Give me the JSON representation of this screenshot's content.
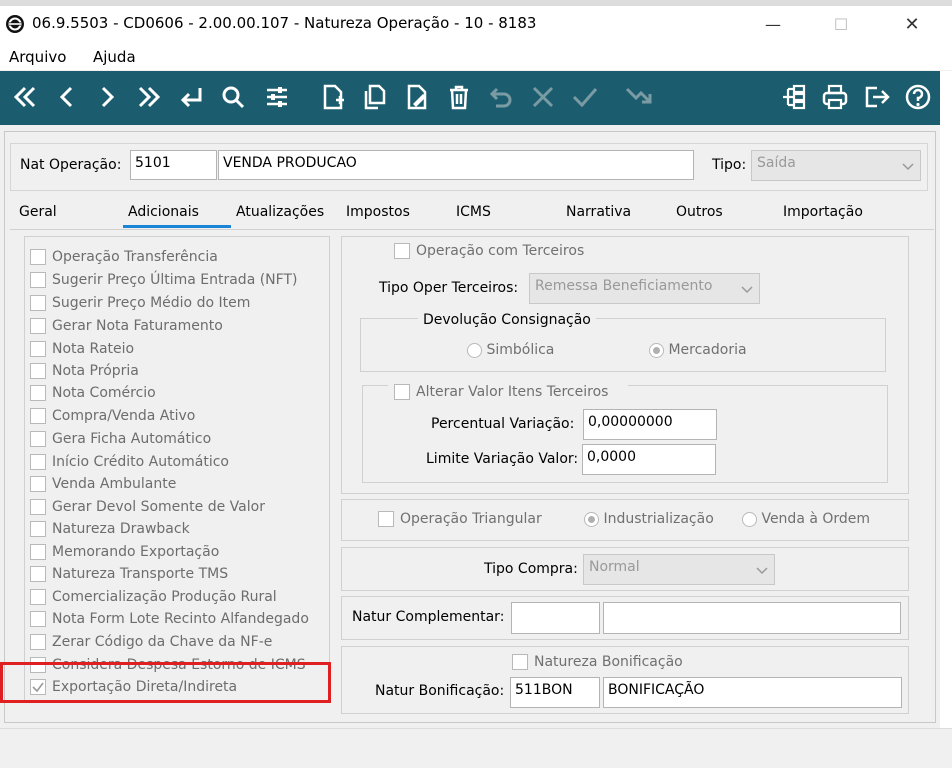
{
  "window": {
    "title": "06.9.5503 - CD0606 - 2.00.00.107 - Natureza Operação - 10 - 8183",
    "minimize_glyph": "—",
    "maximize_glyph": "☐",
    "close_glyph": "✕"
  },
  "menu": {
    "items": [
      "Arquivo",
      "Ajuda"
    ]
  },
  "toolbar": {
    "icons": [
      "first-icon",
      "previous-icon",
      "next-icon",
      "last-icon",
      "goto-icon",
      "search-icon",
      "filter-icon",
      "new-icon",
      "copy-icon",
      "edit-icon",
      "delete-icon",
      "undo-icon",
      "cancel-icon",
      "confirm-icon",
      "send-icon",
      "tree-icon",
      "print-icon",
      "exit-icon",
      "help-icon"
    ]
  },
  "header": {
    "nat_label": "Nat Operação:",
    "nat_code": "5101",
    "nat_desc": "VENDA PRODUCAO",
    "tipo_label": "Tipo:",
    "tipo_value": "Saída"
  },
  "tabs": [
    "Geral",
    "Adicionais",
    "Atualizações",
    "Impostos",
    "ICMS",
    "Narrativa",
    "Outros",
    "Importação"
  ],
  "active_tab": "Adicionais",
  "left_options": [
    {
      "label": "Operação Transferência",
      "checked": false
    },
    {
      "label": "Sugerir Preço Última Entrada (NFT)",
      "checked": false
    },
    {
      "label": "Sugerir Preço Médio do Item",
      "checked": false
    },
    {
      "label": "Gerar Nota Faturamento",
      "checked": false
    },
    {
      "label": "Nota Rateio",
      "checked": false
    },
    {
      "label": "Nota Própria",
      "checked": false
    },
    {
      "label": "Nota Comércio",
      "checked": false
    },
    {
      "label": "Compra/Venda Ativo",
      "checked": false
    },
    {
      "label": "Gera Ficha Automático",
      "checked": false
    },
    {
      "label": "Início Crédito Automático",
      "checked": false
    },
    {
      "label": "Venda Ambulante",
      "checked": false
    },
    {
      "label": "Gerar Devol Somente de Valor",
      "checked": false
    },
    {
      "label": "Natureza Drawback",
      "checked": false
    },
    {
      "label": "Memorando Exportação",
      "checked": false
    },
    {
      "label": "Natureza Transporte TMS",
      "checked": false
    },
    {
      "label": "Comercialização Produção Rural",
      "checked": false
    },
    {
      "label": "Nota Form Lote Recinto Alfandegado",
      "checked": false
    },
    {
      "label": "Zerar Código da Chave da NF-e",
      "checked": false
    },
    {
      "label": "Considera Despesa Estorno de ICMS",
      "checked": false
    },
    {
      "label": "Exportação Direta/Indireta",
      "checked": true
    }
  ],
  "terceiros": {
    "checkbox_label": "Operação com Terceiros",
    "tipo_label": "Tipo Oper Terceiros:",
    "tipo_value": "Remessa Beneficiamento",
    "devolucao_title": "Devolução Consignação",
    "radio_simbolica": "Simbólica",
    "radio_mercadoria": "Mercadoria",
    "alterar_label": "Alterar Valor Itens Terceiros",
    "percentual_label": "Percentual Variação:",
    "percentual_value": "0,00000000",
    "limite_label": "Limite Variação Valor:",
    "limite_value": "0,0000"
  },
  "triangular": {
    "checkbox_label": "Operação Triangular",
    "radio_industrializacao": "Industrialização",
    "radio_venda": "Venda à Ordem"
  },
  "compra": {
    "label": "Tipo Compra:",
    "value": "Normal"
  },
  "complementar": {
    "label": "Natur Complementar:",
    "code": "",
    "desc": ""
  },
  "bonificacao": {
    "checkbox_label": "Natureza Bonificação",
    "label": "Natur Bonificação:",
    "code": "511BON",
    "desc": "BONIFICAÇÃO"
  },
  "colors": {
    "toolbar": "#1b5d6e",
    "highlight": "#e02020",
    "tab_underline": "#1a84d6"
  }
}
